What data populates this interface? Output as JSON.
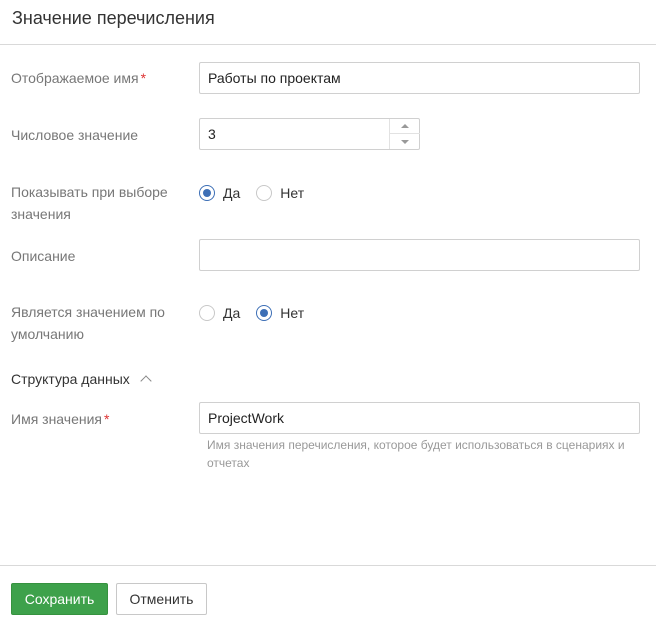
{
  "header": {
    "title": "Значение перечисления"
  },
  "fields": {
    "display_name": {
      "label": "Отображаемое имя",
      "required_mark": "*",
      "value": "Работы по проектам"
    },
    "numeric_value": {
      "label": "Числовое значение",
      "value": "3"
    },
    "show_on_select": {
      "label": "Показывать при выборе значения",
      "option_yes": "Да",
      "option_no": "Нет",
      "selected": "yes"
    },
    "description": {
      "label": "Описание",
      "value": ""
    },
    "is_default": {
      "label": "Является значением по умолчанию",
      "option_yes": "Да",
      "option_no": "Нет",
      "selected": "no"
    }
  },
  "data_structure": {
    "title": "Структура данных",
    "value_name": {
      "label": "Имя значения",
      "required_mark": "*",
      "value": "ProjectWork",
      "hint": "Имя значения перечисления, которое будет использоваться в сценариях и отчетах"
    }
  },
  "footer": {
    "save_label": "Сохранить",
    "cancel_label": "Отменить"
  },
  "colors": {
    "accent": "#3d6fb6",
    "save_button": "#3ea14b",
    "required": "#dd3333"
  }
}
